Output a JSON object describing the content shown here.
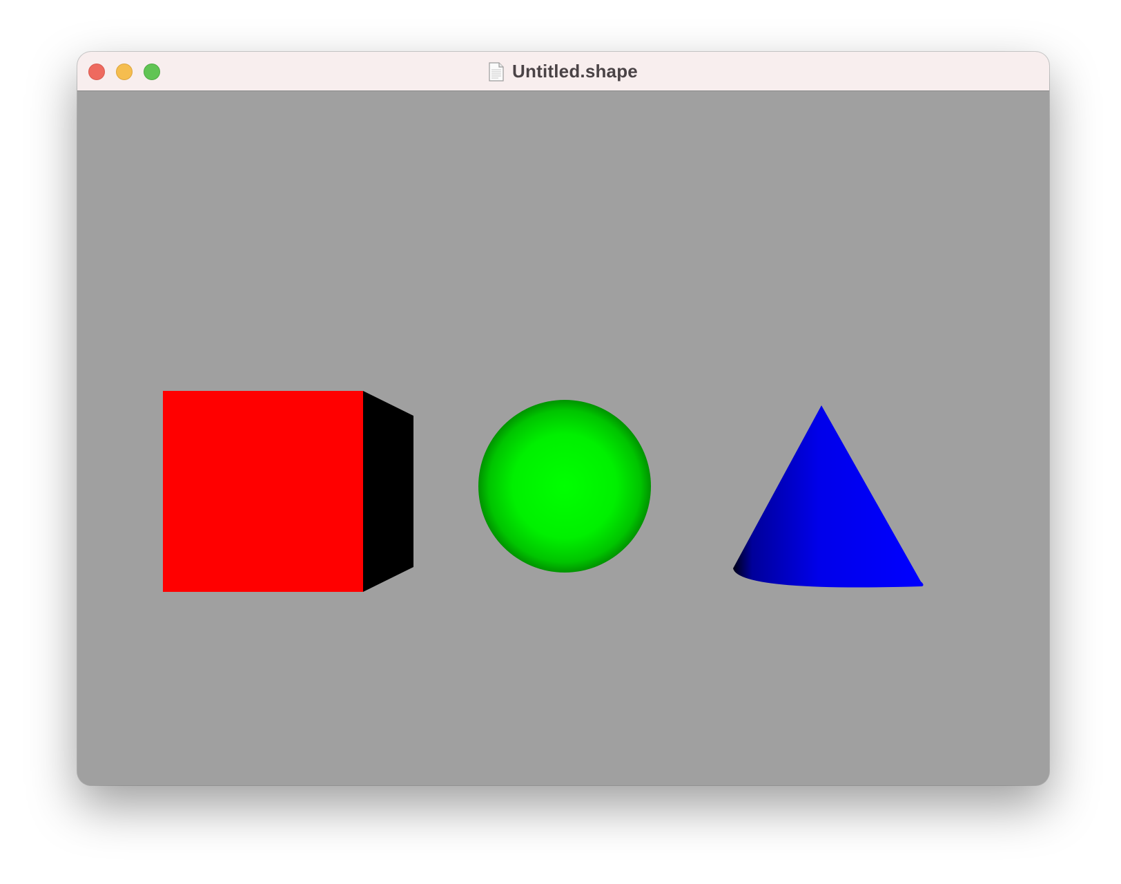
{
  "window": {
    "title": "Untitled.shape",
    "document_icon": "document-icon",
    "traffic_lights": {
      "close": "close-button",
      "minimize": "minimize-button",
      "zoom": "zoom-button"
    }
  },
  "scene": {
    "background_color": "#a0a0a0",
    "shapes": [
      {
        "name": "cube",
        "front_color": "#ff0000",
        "side_color": "#000000"
      },
      {
        "name": "sphere",
        "color": "#00ff00"
      },
      {
        "name": "cone",
        "color": "#0000ff"
      }
    ]
  }
}
